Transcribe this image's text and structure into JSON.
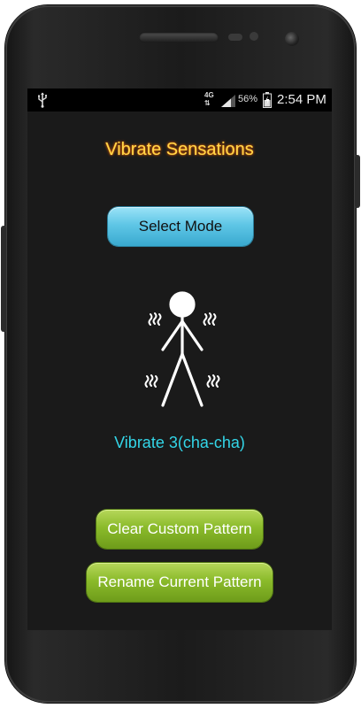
{
  "status_bar": {
    "network_type": "4G",
    "battery_percent": "56%",
    "time": "2:54 PM",
    "icons": [
      "usb-icon",
      "network-arrows-icon",
      "signal-icon",
      "battery-charging-icon"
    ]
  },
  "app": {
    "title": "Vibrate Sensations",
    "select_mode_label": "Select Mode",
    "current_mode": "Vibrate 3(cha-cha)",
    "clear_button_label": "Clear Custom Pattern",
    "rename_button_label": "Rename Current Pattern"
  },
  "colors": {
    "title": "#ffd84a",
    "title_glow": "#ff6a00",
    "mode_label": "#33d6e8",
    "select_button": "#5fc6e6",
    "action_buttons": "#8bbb2b",
    "screen_background": "#1a1a1a"
  }
}
